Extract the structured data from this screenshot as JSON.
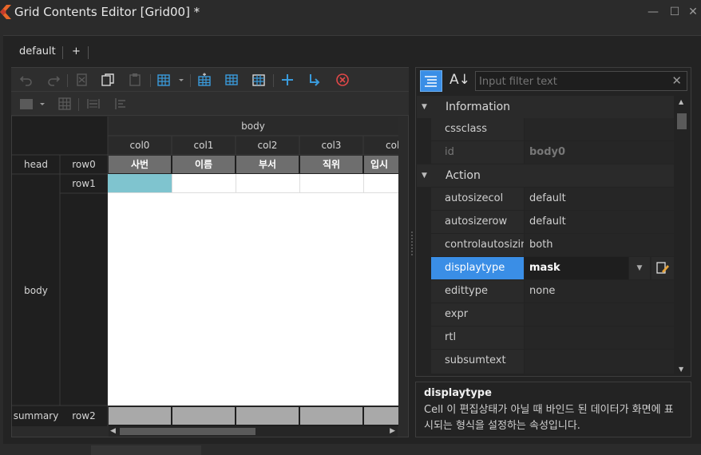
{
  "window": {
    "title": "Grid Contents Editor [Grid00] *",
    "minimize": "—",
    "maximize": "☐",
    "close": "✕"
  },
  "tabs": [
    {
      "label": "default"
    },
    {
      "label": "+"
    }
  ],
  "toolbar_icons": {
    "row1": [
      "undo-icon",
      "redo-icon",
      "cut-icon",
      "copy-icon",
      "paste-icon",
      "format-icon",
      "add-column-icon",
      "add-row-icon",
      "insert-band-icon",
      "add-icon",
      "arrow-down-right-icon",
      "delete-icon"
    ],
    "row2": [
      "cell-style-icon",
      "grid-icon",
      "merge-icon",
      "split-icon"
    ]
  },
  "grid": {
    "band_label": "body",
    "columns": [
      "col0",
      "col1",
      "col2",
      "col3",
      "col"
    ],
    "rows": [
      {
        "band": "head",
        "row": "row0",
        "cells": [
          "사번",
          "이름",
          "부서",
          "직위",
          "입시"
        ]
      },
      {
        "band": "",
        "row": "row1",
        "cells": [
          "",
          "",
          "",
          "",
          ""
        ]
      },
      {
        "band": "body",
        "row": "",
        "cells": []
      },
      {
        "band": "summary",
        "row": "row2",
        "cells": [
          "",
          "",
          "",
          "",
          ""
        ]
      }
    ]
  },
  "filter": {
    "placeholder": "Input filter text"
  },
  "properties": {
    "categories": [
      {
        "name": "Information",
        "items": [
          {
            "name": "cssclass",
            "value": ""
          },
          {
            "name": "id",
            "value": "body0"
          }
        ]
      },
      {
        "name": "Action",
        "items": [
          {
            "name": "autosizecol",
            "value": "default"
          },
          {
            "name": "autosizerow",
            "value": "default"
          },
          {
            "name": "controlautosizing",
            "value": "both"
          },
          {
            "name": "displaytype",
            "value": "mask"
          },
          {
            "name": "edittype",
            "value": "none"
          },
          {
            "name": "expr",
            "value": ""
          },
          {
            "name": "rtl",
            "value": ""
          },
          {
            "name": "subsumtext",
            "value": ""
          }
        ]
      }
    ]
  },
  "description": {
    "title": "displaytype",
    "text": "Cell 이 편집상태가 아닐 때 바인드 된 데이터가 화면에 표시되는 형식을 설정하는 속성입니다."
  },
  "colors": {
    "selected": "#3a8ee6",
    "selected_cell": "#7fc4cf",
    "header_cell": "#6e6e6e",
    "summary_cell": "#a9a9a9",
    "accent_icon": "#3a9bdc",
    "delete_icon": "#e04848"
  }
}
